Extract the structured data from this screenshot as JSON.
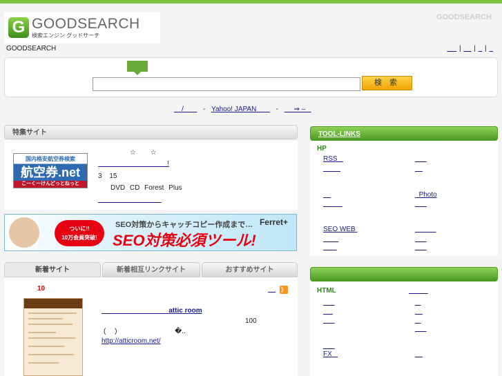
{
  "header": {
    "logo_word": "GOODSEARCH",
    "logo_sub": "検索エンジン グッドサーチ",
    "logo_letter": "G",
    "top_right": "GOODSEARCH",
    "brand_name": "GOODSEARCH",
    "top_links": [
      "",
      "",
      "",
      ""
    ]
  },
  "search": {
    "value": "",
    "button_label": "検 索"
  },
  "sub_links": {
    "link1": "/",
    "sep1": "-",
    "link2": "Yahoo! JAPAN",
    "sep2": "-",
    "link3": "⇒ –"
  },
  "feature": {
    "title": "特集サイト",
    "stars": "☆ ☆",
    "link1": "!",
    "line1": "3 15",
    "line2": "DVD CD Forest Plus",
    "link2": "",
    "img_top": "国内格安航空券検索",
    "img_mid": "航空券.net",
    "img_bot": "こーくーけんどっとねっと"
  },
  "ad": {
    "bubble": "ついに!!\n10万会員突破!",
    "line1": "SEO対策からキャッチコピー作成まで…",
    "line2": "SEO対策必須ツール!",
    "brand": "Ferret+"
  },
  "tabs": [
    "新着サイト",
    "新着相互リンクサイト",
    "おすすめサイト"
  ],
  "new_sites": {
    "count": "10",
    "top_link": "",
    "rss": "》",
    "site_title": "attic room",
    "num": "100",
    "paren": "(   )",
    "garbled": "�..",
    "url": "http://atticroom.net/"
  },
  "tool_links": {
    "title": "TOOL-LINKS",
    "category": "HP",
    "col1": [
      "RSS",
      "",
      "",
      "",
      "SEO WEB",
      "",
      ""
    ],
    "col2": [
      "",
      "",
      "Photo",
      "",
      "",
      "",
      ""
    ]
  },
  "box2": {
    "title": "",
    "category": "HTML",
    "cat_link": "",
    "col1": [
      "",
      "",
      "",
      "",
      "FX"
    ],
    "col2": [
      "",
      "",
      "",
      "",
      ""
    ]
  },
  "colors": {
    "accent_green": "#7cc040",
    "search_button": "#f0a400",
    "link": "#1a1a8c"
  },
  "icons": [
    "g-logo-icon",
    "rss-icon",
    "tab-marker-icon"
  ]
}
